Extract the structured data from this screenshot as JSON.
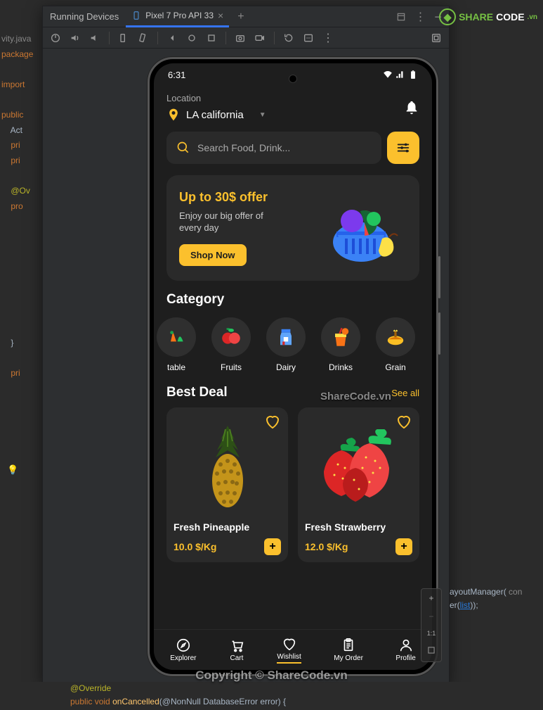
{
  "ide": {
    "code_lines": [
      "vity.java",
      "package",
      "",
      "import",
      "",
      "public",
      "    Act",
      "    pri",
      "    pri",
      "",
      "    @Ov",
      "    pro",
      "",
      "",
      "",
      "",
      "",
      "",
      "",
      "",
      "",
      "    }",
      "",
      "    pri"
    ],
    "bottom_line1_annotation": "@Override",
    "bottom_line2_kw1": "public",
    "bottom_line2_kw2": "void",
    "bottom_line2_fn": "onCancelled",
    "bottom_line2_rest": "(@NonNull DatabaseError error) {",
    "right_snippet_pre": "ayoutManager( ",
    "right_snippet_kw": "con",
    "right_snippet2_pre": "er(",
    "right_snippet2_link": "list",
    "right_snippet2_post": "));"
  },
  "panel": {
    "title": "Running Devices",
    "tab_label": "Pixel 7 Pro API 33"
  },
  "statusbar": {
    "time": "6:31"
  },
  "app": {
    "location_label": "Location",
    "location_value": "LA california",
    "search_placeholder": "Search Food, Drink...",
    "promo_title": "Up to 30$ offer",
    "promo_sub": "Enjoy our big offer of every day",
    "promo_btn": "Shop Now",
    "category_title": "Category",
    "categories": [
      {
        "label": "table"
      },
      {
        "label": "Fruits"
      },
      {
        "label": "Dairy"
      },
      {
        "label": "Drinks"
      },
      {
        "label": "Grain"
      }
    ],
    "bestdeal_title": "Best Deal",
    "see_all": "See all",
    "deals": [
      {
        "name": "Fresh Pineapple",
        "price": "10.0 $/Kg"
      },
      {
        "name": "Fresh Strawberry",
        "price": "12.0 $/Kg"
      }
    ],
    "nav": [
      {
        "label": "Explorer"
      },
      {
        "label": "Cart"
      },
      {
        "label": "Wishlist"
      },
      {
        "label": "My Order"
      },
      {
        "label": "Profile"
      }
    ]
  },
  "zoom": {
    "ratio": "1:1"
  },
  "watermark": {
    "brand1": "SHARE",
    "brand2": "CODE",
    "tld": ".vn",
    "mid": "ShareCode.vn",
    "copyright": "Copyright © ShareCode.vn"
  }
}
